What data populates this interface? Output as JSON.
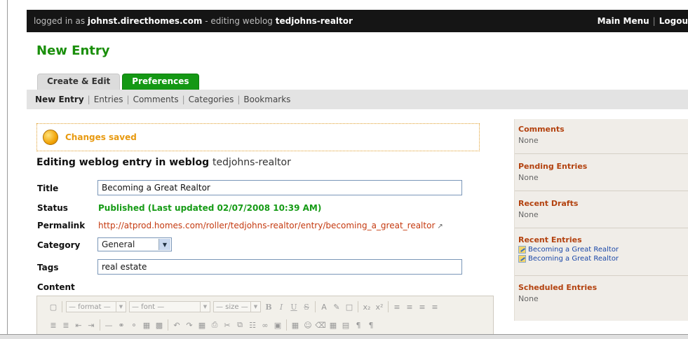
{
  "topbar": {
    "prefix": "logged in as",
    "username": "johnst.directhomes.com",
    "middle": "- editing weblog",
    "weblog": "tedjohns-realtor",
    "main_menu": "Main Menu",
    "separator": "|",
    "logout": "Logou"
  },
  "page_title": "New Entry",
  "tabs": [
    {
      "label": "Create & Edit",
      "active": false
    },
    {
      "label": "Preferences",
      "active": true
    }
  ],
  "subnav": {
    "items": [
      "New Entry",
      "Entries",
      "Comments",
      "Categories",
      "Bookmarks"
    ],
    "separator": "|"
  },
  "notice": {
    "message": "Changes saved"
  },
  "editing": {
    "heading": "Editing weblog entry in weblog",
    "weblog": "tedjohns-realtor"
  },
  "form": {
    "title_label": "Title",
    "title_value": "Becoming a Great Realtor",
    "status_label": "Status",
    "status_value": "Published (Last updated 02/07/2008 10:39 AM)",
    "permalink_label": "Permalink",
    "permalink_value": "http://atprod.homes.com/roller/tedjohns-realtor/entry/becoming_a_great_realtor",
    "category_label": "Category",
    "category_value": "General",
    "tags_label": "Tags",
    "tags_value": "real estate",
    "content_label": "Content"
  },
  "editor_toolbar": {
    "format_select": "— format —",
    "font_select": "— font —",
    "size_select": "— size —",
    "bold": "B",
    "italic": "I",
    "underline": "U",
    "strike": "S"
  },
  "sidebar": {
    "sections": [
      {
        "title": "Comments",
        "items": [],
        "empty": "None"
      },
      {
        "title": "Pending Entries",
        "items": [],
        "empty": "None"
      },
      {
        "title": "Recent Drafts",
        "items": [],
        "empty": "None"
      },
      {
        "title": "Recent Entries",
        "items": [
          "Becoming a Great Realtor",
          "Becoming a Great Realtor"
        ]
      },
      {
        "title": "Scheduled Entries",
        "items": [],
        "empty": "None"
      }
    ]
  },
  "colors": {
    "brand_green": "#1a8f0b",
    "tab_active": "#149814",
    "sidebar_title": "#b3420f",
    "link": "#c53a10",
    "notice": "#e89a10"
  }
}
